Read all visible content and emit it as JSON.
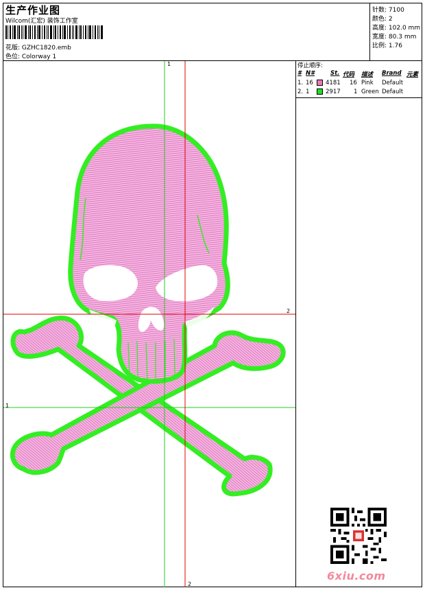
{
  "header": {
    "title": "生产作业图",
    "software": "Wilcom(汇宏) 装饰工作室",
    "design_line": "花版:  GZHC1820.emb",
    "colorway_line": "色位:  Colorway 1"
  },
  "stats": [
    {
      "label": "针数",
      "value": "7100"
    },
    {
      "label": "颜色",
      "value": "2"
    },
    {
      "label": "高度",
      "value": "102.0 mm"
    },
    {
      "label": "宽度",
      "value": "80.3 mm"
    },
    {
      "label": "比例",
      "value": "1.76"
    }
  ],
  "stop_sequence": {
    "heading": "停止顺序:",
    "columns": [
      "#",
      "N#",
      "St.",
      "代码",
      "描述",
      "Brand",
      "元素"
    ],
    "rows": [
      {
        "index": "1.",
        "needle": "16",
        "swatch_color": "#ee7ab8",
        "code": "4181",
        "st": "16",
        "desc": "Pink",
        "brand": "Default"
      },
      {
        "index": "2.",
        "needle": "1",
        "swatch_color": "#22dd22",
        "code": "2917",
        "st": "1",
        "desc": "Green",
        "brand": "Default"
      }
    ]
  },
  "guides": {
    "green_label_top": "1",
    "green_label_left": "1",
    "red_label_right": "2",
    "red_label_bottom": "2",
    "green_color": "#22cc22",
    "red_color": "#e00000"
  },
  "design": {
    "fill_color": "#efa3d6",
    "stitch_color": "#e170c2",
    "border_color": "#33ee22"
  },
  "watermark": "6xiu.com"
}
